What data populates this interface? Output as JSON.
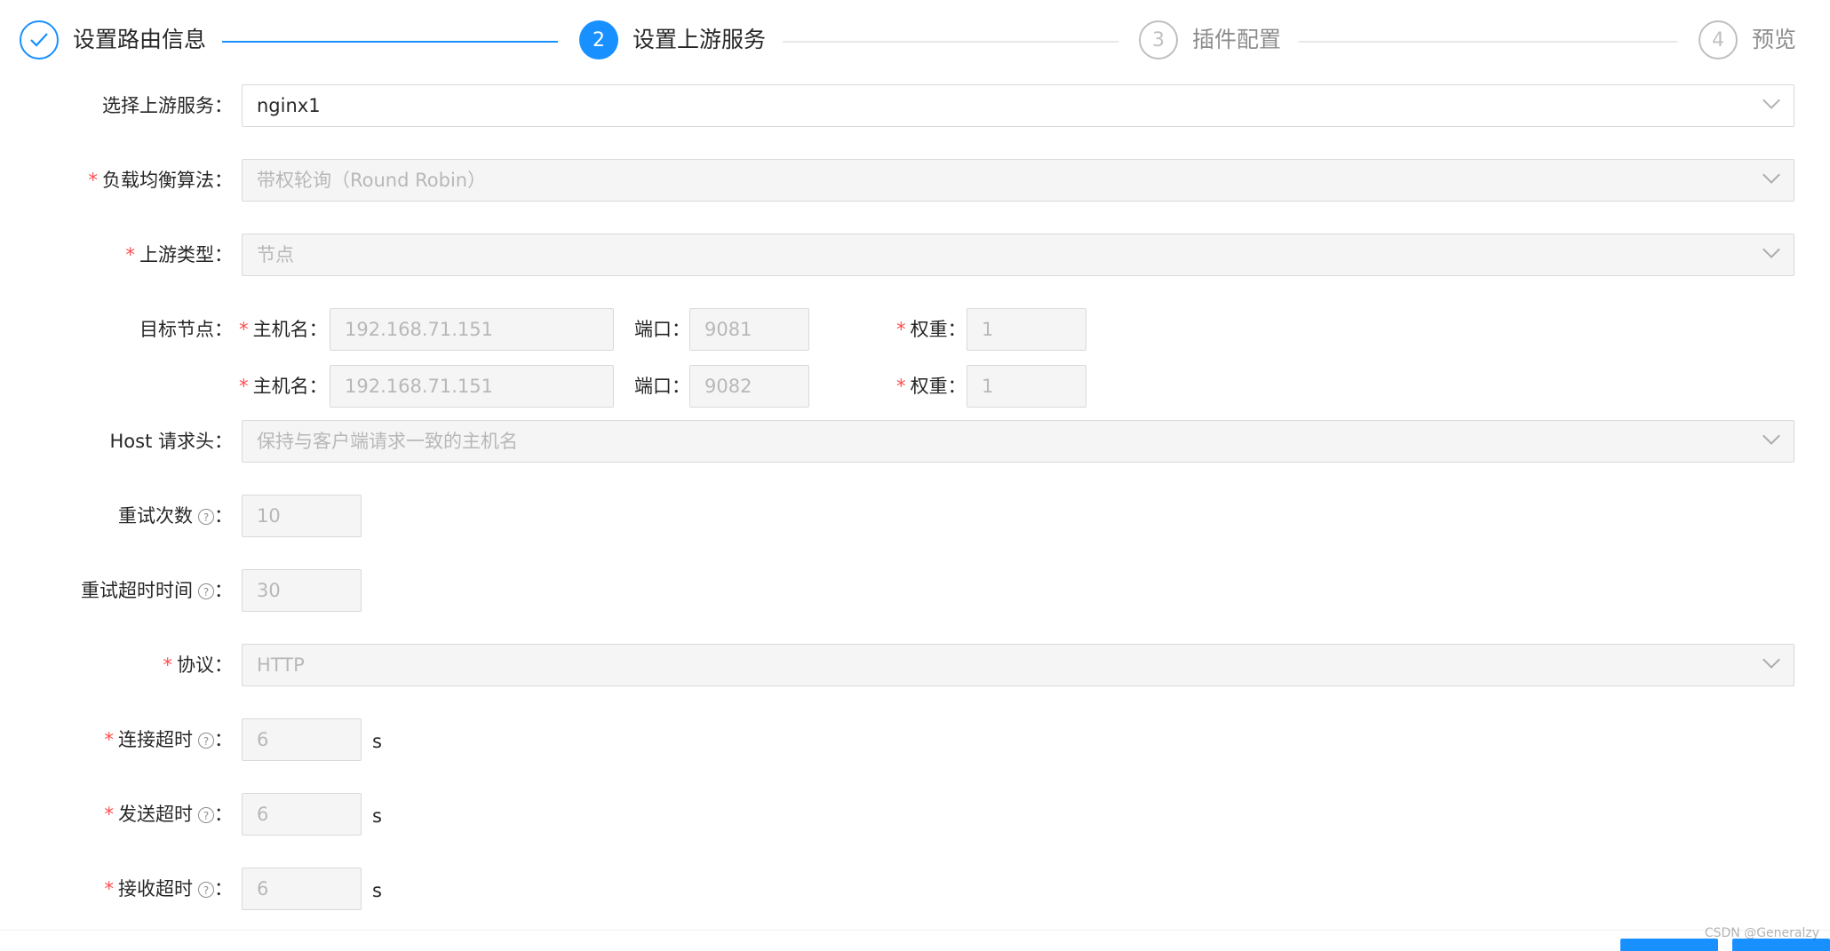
{
  "steps": [
    {
      "number": "",
      "title": "设置路由信息",
      "status": "finish"
    },
    {
      "number": "2",
      "title": "设置上游服务",
      "status": "process"
    },
    {
      "number": "3",
      "title": "插件配置",
      "status": "wait"
    },
    {
      "number": "4",
      "title": "预览",
      "status": "wait"
    }
  ],
  "form": {
    "upstream": {
      "label": "选择上游服务",
      "value": "nginx1"
    },
    "lb": {
      "label": "负载均衡算法",
      "value": "带权轮询（Round Robin）"
    },
    "upstream_type": {
      "label": "上游类型",
      "value": "节点"
    },
    "nodes": {
      "label": "目标节点",
      "host_label": "主机名",
      "port_label": "端口",
      "weight_label": "权重",
      "items": [
        {
          "host": "192.168.71.151",
          "port": "9081",
          "weight": "1"
        },
        {
          "host": "192.168.71.151",
          "port": "9082",
          "weight": "1"
        }
      ]
    },
    "host_header": {
      "label": "Host 请求头",
      "value": "保持与客户端请求一致的主机名"
    },
    "retries": {
      "label": "重试次数",
      "value": "10"
    },
    "retry_timeout": {
      "label": "重试超时时间",
      "value": "30"
    },
    "scheme": {
      "label": "协议",
      "value": "HTTP"
    },
    "connect_timeout": {
      "label": "连接超时",
      "value": "6",
      "unit": "s"
    },
    "send_timeout": {
      "label": "发送超时",
      "value": "6",
      "unit": "s"
    },
    "read_timeout": {
      "label": "接收超时",
      "value": "6",
      "unit": "s"
    }
  },
  "colon": "：",
  "required_mark": "*",
  "help_glyph": "?",
  "watermark": "CSDN @Generalzy",
  "colors": {
    "primary": "#1890ff",
    "required": "#ff4d4f",
    "disabled_bg": "#f5f5f5",
    "border": "#d9d9d9"
  }
}
